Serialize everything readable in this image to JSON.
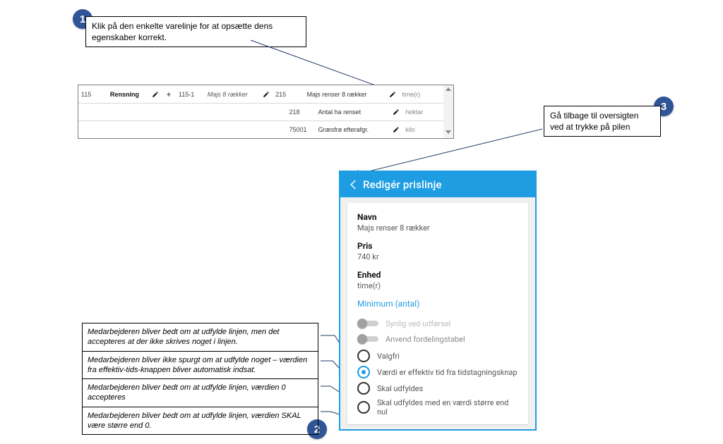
{
  "callouts": {
    "c1": "Klik på den enkelte varelinje for at opsætte dens egenskaber korrekt.",
    "c3": "Gå tilbage til oversigten ved at trykke på pilen"
  },
  "badges": {
    "b1": "1",
    "b2": "2",
    "b3": "3"
  },
  "table": {
    "rows": [
      {
        "id1": "115",
        "name1": "Rensning",
        "id2": "115-1",
        "name2": "Majs 8 rækker",
        "id3": "215",
        "name3": "Majs renser 8 rækker",
        "unit": "time(r)"
      },
      {
        "id1": "",
        "name1": "",
        "id2": "",
        "name2": "",
        "id3": "218",
        "name3": "Antal ha renset",
        "unit": "hektar"
      },
      {
        "id1": "",
        "name1": "",
        "id2": "",
        "name2": "",
        "id3": "75001",
        "name3": "Græsfrø efterafgr.",
        "unit": "kilo"
      }
    ]
  },
  "phone": {
    "title": "Redigér prislinje",
    "navn_label": "Navn",
    "navn_value": "Majs renser 8 rækker",
    "pris_label": "Pris",
    "pris_value": "740 kr",
    "enhed_label": "Enhed",
    "enhed_value": "time(r)",
    "minimum_link": "Minimum (antal)",
    "toggle1": "Synlig ved udførsel",
    "toggle2": "Anvend fordelingstabel",
    "radio1": "Valgfri",
    "radio2": "Værdi er effektiv tid fra tidstagningsknap",
    "radio3": "Skal udfyldes",
    "radio4": "Skal udfyldes med en værdi større end nul"
  },
  "explain": {
    "r1": "Medarbejderen bliver bedt om at udfylde linjen, men det accepteres at der ikke skrives noget i linjen.",
    "r2": "Medarbejderen bliver ikke spurgt om at udfylde noget – værdien fra effektiv-tids-knappen bliver automatisk indsat.",
    "r3": "Medarbejderen bliver bedt om at udfylde linjen, værdien 0 accepteres",
    "r4": "Medarbejderen bliver bedt om at udfylde linjen, værdien SKAL være større end 0."
  }
}
